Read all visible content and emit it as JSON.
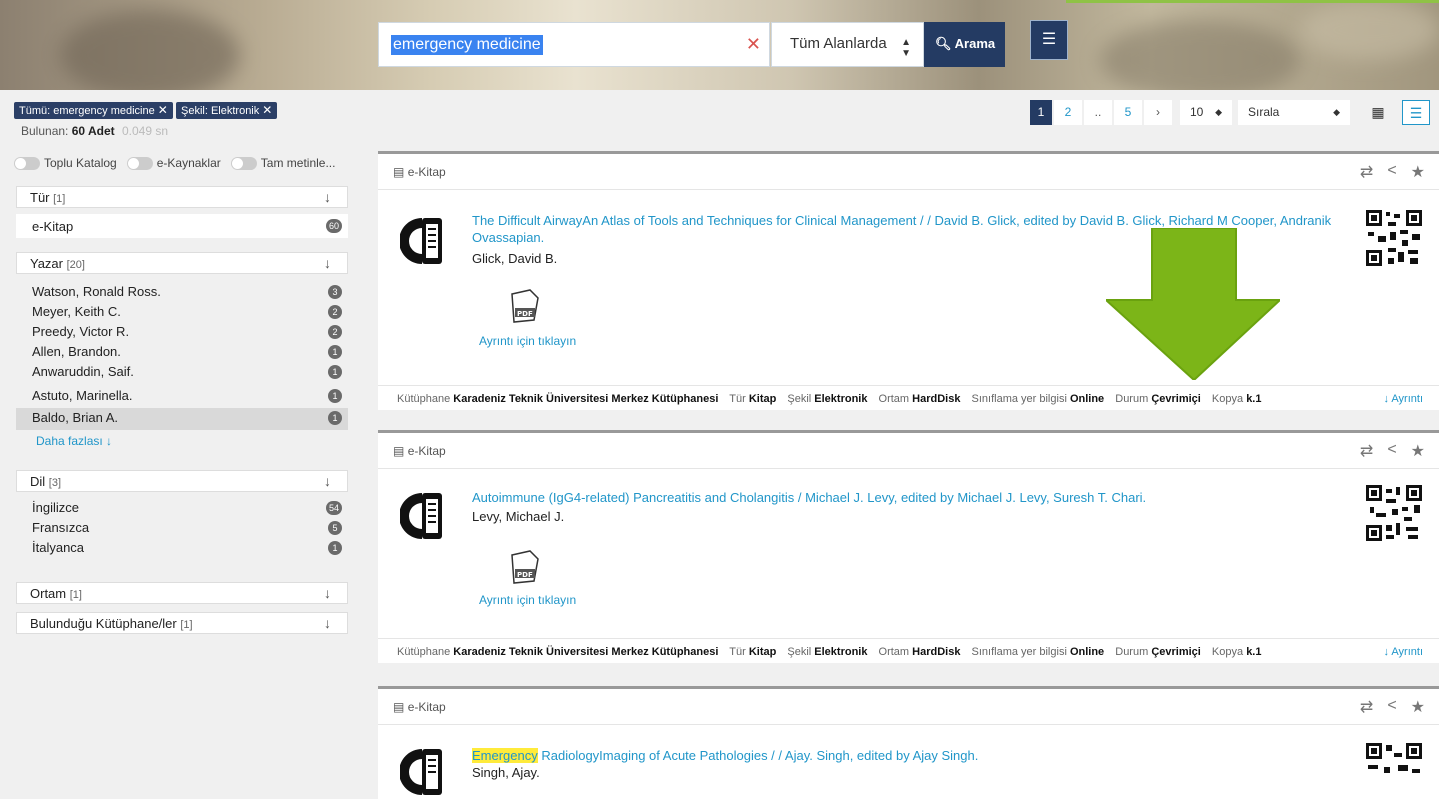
{
  "search": {
    "query": "emergency medicine",
    "clear_icon": "close-icon",
    "scope_label": "Tüm Alanlarda",
    "search_button": "Arama",
    "list_button_icon": "list-icon"
  },
  "filters": {
    "tags": [
      {
        "label": "Tümü: emergency medicine"
      },
      {
        "label": "Şekil: Elektronik"
      }
    ],
    "found_label": "Bulunan:",
    "found_count": "60 Adet",
    "found_time": "0.049 sn",
    "toggles": [
      "Toplu Katalog",
      "e-Kaynaklar",
      "Tam metinle..."
    ]
  },
  "facets": {
    "tur": {
      "title": "Tür",
      "count": "[1]",
      "items": [
        {
          "label": "e-Kitap",
          "count": "60"
        }
      ]
    },
    "yazar": {
      "title": "Yazar",
      "count": "[20]",
      "items": [
        {
          "label": "Watson, Ronald Ross.",
          "count": "3"
        },
        {
          "label": "Meyer, Keith C.",
          "count": "2"
        },
        {
          "label": "Preedy, Victor R.",
          "count": "2"
        },
        {
          "label": "Allen, Brandon.",
          "count": "1"
        },
        {
          "label": "Anwaruddin, Saif.",
          "count": "1"
        },
        {
          "label": "Astuto, Marinella.",
          "count": "1"
        },
        {
          "label": "Baldo, Brian A.",
          "count": "1"
        }
      ],
      "more": "Daha fazlası"
    },
    "dil": {
      "title": "Dil",
      "count": "[3]",
      "items": [
        {
          "label": "İngilizce",
          "count": "54"
        },
        {
          "label": "Fransızca",
          "count": "5"
        },
        {
          "label": "İtalyanca",
          "count": "1"
        }
      ]
    },
    "ortam": {
      "title": "Ortam",
      "count": "[1]"
    },
    "kutuphane": {
      "title": "Bulunduğu Kütüphane/ler",
      "count": "[1]"
    }
  },
  "pager": {
    "pages": [
      "1",
      "2",
      "..",
      "5",
      "›"
    ],
    "per_page": "10",
    "sort_label": "Sırala"
  },
  "results": [
    {
      "type": "e-Kitap",
      "title": "The Difficult AirwayAn Atlas of Tools and Techniques for Clinical Management / / David B. Glick, edited by David B. Glick, Richard M Cooper, Andranik Ovassapian.",
      "author": "Glick, David B.",
      "detail_link": "Ayrıntı için tıklayın",
      "meta": {
        "k1": "Kütüphane",
        "v1": "Karadeniz Teknik Üniversitesi Merkez Kütüphanesi",
        "k2": "Tür",
        "v2": "Kitap",
        "k3": "Şekil",
        "v3": "Elektronik",
        "k4": "Ortam",
        "v4": "HardDisk",
        "k5": "Sınıflama yer bilgisi",
        "v5": "Online",
        "k6": "Durum",
        "v6": "Çevrimiçi",
        "k7": "Kopya",
        "v7": "k.1",
        "more": "Ayrıntı"
      }
    },
    {
      "type": "e-Kitap",
      "title": "Autoimmune (IgG4-related) Pancreatitis and Cholangitis / Michael J. Levy, edited by Michael J. Levy, Suresh T. Chari.",
      "author": "Levy, Michael J.",
      "detail_link": "Ayrıntı için tıklayın",
      "meta": {
        "k1": "Kütüphane",
        "v1": "Karadeniz Teknik Üniversitesi Merkez Kütüphanesi",
        "k2": "Tür",
        "v2": "Kitap",
        "k3": "Şekil",
        "v3": "Elektronik",
        "k4": "Ortam",
        "v4": "HardDisk",
        "k5": "Sınıflama yer bilgisi",
        "v5": "Online",
        "k6": "Durum",
        "v6": "Çevrimiçi",
        "k7": "Kopya",
        "v7": "k.1",
        "more": "Ayrıntı"
      }
    },
    {
      "type": "e-Kitap",
      "title_highlight": "Emergency",
      "title": " RadiologyImaging of Acute Pathologies / / Ajay. Singh, edited by Ajay Singh.",
      "author": "Singh, Ajay."
    }
  ],
  "colors": {
    "accent": "#2196c9",
    "navy": "#243b63",
    "arrow": "#7cb518"
  }
}
